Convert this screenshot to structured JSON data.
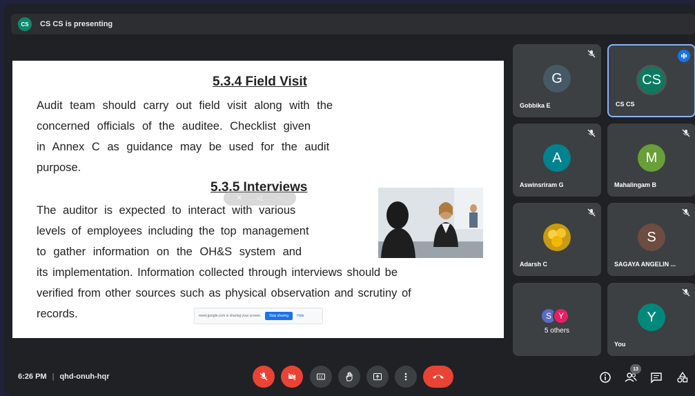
{
  "presenting": {
    "avatar_initials": "CS",
    "text": "CS CS is presenting"
  },
  "slide": {
    "heading1": "5.3.4 Field Visit",
    "para1": [
      "Audit team should carry out field visit along with the",
      "concerned officials of the auditee. Checklist given",
      "in Annex C as guidance may be used for the audit",
      "purpose."
    ],
    "heading2": "5.3.5 Interviews",
    "para2": [
      "The auditor is expected to interact with various",
      "levels of employees including the top management",
      "to gather information on the OH&S system and",
      "its implementation. Information collected through interviews should be",
      " verified from other sources such as physical observation and scrutiny of",
      "records."
    ],
    "share_banner": {
      "text": "meet.google.com is sharing your screen.",
      "stop_label": "Stop sharing",
      "hide_label": "Hide"
    }
  },
  "participants": [
    {
      "name": "Gobbika E",
      "initial": "G",
      "color": "#455a64",
      "muted": true,
      "speaking": false
    },
    {
      "name": "CS CS",
      "initial": "CS",
      "color": "#0b7a60",
      "muted": false,
      "speaking": true
    },
    {
      "name": "Aswinsriram G",
      "initial": "A",
      "color": "#00838f",
      "muted": true,
      "speaking": false
    },
    {
      "name": "Mahalingam B",
      "initial": "M",
      "color": "#689f38",
      "muted": true,
      "speaking": false
    },
    {
      "name": "Adarsh C",
      "initial": "",
      "color": "#f2b705",
      "muted": true,
      "speaking": false
    },
    {
      "name": "SAGAYA ANGELIN ...",
      "initial": "S",
      "color": "#6d4c41",
      "muted": true,
      "speaking": false
    },
    {
      "name": "You",
      "initial": "Y",
      "color": "#00897b",
      "muted": true,
      "speaking": false
    }
  ],
  "others": {
    "label": "5 others",
    "avatars": [
      {
        "initial": "S",
        "color": "#5c6bc0"
      },
      {
        "initial": "Y",
        "color": "#e91e63"
      }
    ]
  },
  "bottom": {
    "time": "6:26 PM",
    "meeting_code": "qhd-onuh-hqr",
    "participant_count": "13"
  }
}
